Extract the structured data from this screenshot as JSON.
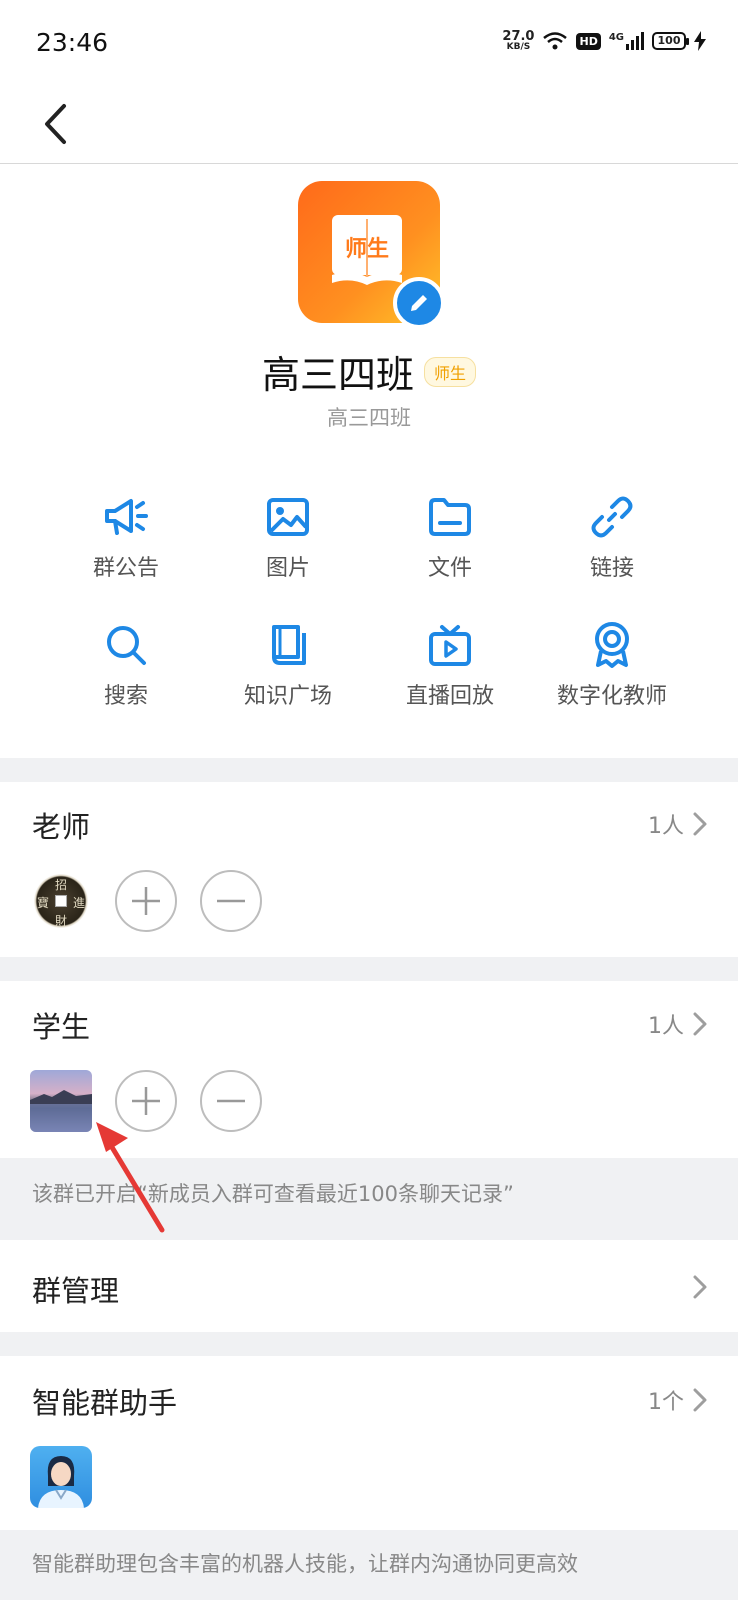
{
  "status_bar": {
    "time": "23:46",
    "net_speed_value": "27.0",
    "net_speed_unit": "KB/S",
    "hd_label": "HD",
    "network_label": "4G",
    "battery_level": "100"
  },
  "group": {
    "avatar_text": "师生",
    "name": "高三四班",
    "role_tag": "师生",
    "subname": "高三四班"
  },
  "features": [
    {
      "label": "群公告",
      "icon": "megaphone-icon"
    },
    {
      "label": "图片",
      "icon": "image-icon"
    },
    {
      "label": "文件",
      "icon": "folder-icon"
    },
    {
      "label": "链接",
      "icon": "link-icon"
    },
    {
      "label": "搜索",
      "icon": "search-icon"
    },
    {
      "label": "知识广场",
      "icon": "book-icon"
    },
    {
      "label": "直播回放",
      "icon": "tv-icon"
    },
    {
      "label": "数字化教师",
      "icon": "award-icon"
    }
  ],
  "teachers": {
    "title": "老师",
    "count": "1人"
  },
  "students": {
    "title": "学生",
    "count": "1人"
  },
  "coin_chars": [
    "招",
    "進",
    "財",
    "寶"
  ],
  "notice": "该群已开启“新成员入群可查看最近100条聊天记录”",
  "group_manage": {
    "title": "群管理"
  },
  "assistant": {
    "title": "智能群助手",
    "count": "1个",
    "description": "智能群助理包含丰富的机器人技能，让群内沟通协同更高效"
  },
  "colors": {
    "accent_blue": "#1e88e5",
    "annotation_red": "#e53935",
    "gap_gray": "#f0f1f3"
  }
}
